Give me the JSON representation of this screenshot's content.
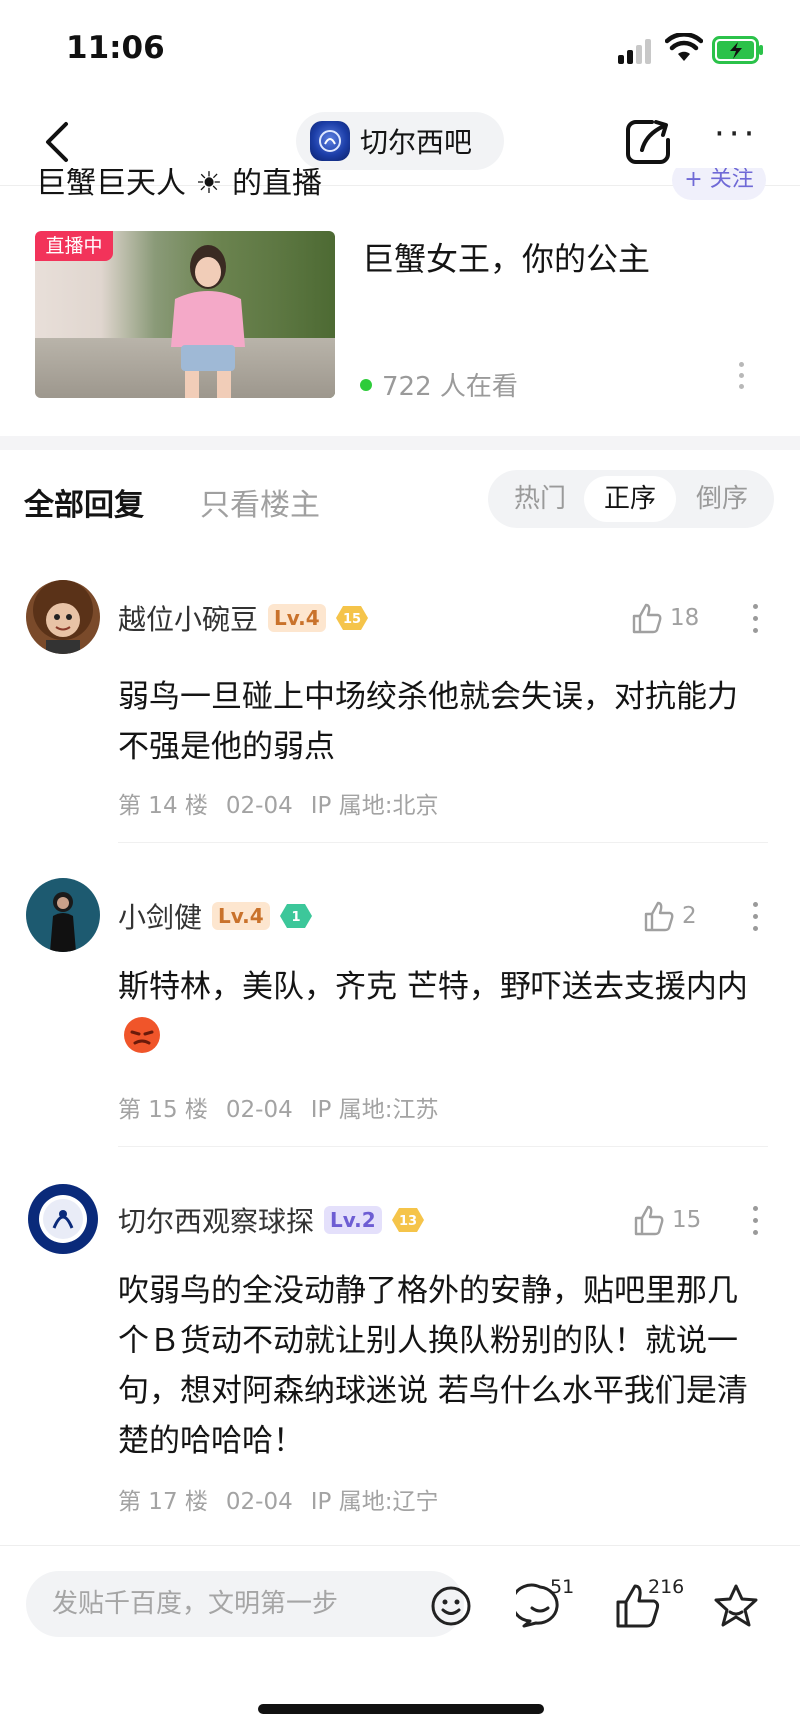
{
  "status": {
    "time": "11:06"
  },
  "nav": {
    "forum_name": "切尔西吧"
  },
  "live": {
    "title": "巨蟹巨天人 ☀ 的直播",
    "follow_label": "+ 关注",
    "badge": "直播中",
    "caption": "巨蟹女王，你的公主",
    "viewers": "722 人在看"
  },
  "filters": {
    "all": "全部回复",
    "owner_only": "只看楼主",
    "sort": [
      "热门",
      "正序",
      "倒序"
    ],
    "active_sort": "正序"
  },
  "replies": [
    {
      "user": "越位小碗豆",
      "level": "Lv.4",
      "badge": "15",
      "likes": "18",
      "text": "弱鸟一旦碰上中场绞杀他就会失误，对抗能力不强是他的弱点",
      "floor": "第 14 楼",
      "date": "02-04",
      "ip": "IP 属地:北京"
    },
    {
      "user": "小剑健",
      "level": "Lv.4",
      "badge": "1",
      "likes": "2",
      "text": "斯特林，美队，齐克 芒特，野吓送去支援内内",
      "floor": "第 15 楼",
      "date": "02-04",
      "ip": "IP 属地:江苏"
    },
    {
      "user": "切尔西观察球探",
      "level": "Lv.2",
      "badge": "13",
      "likes": "15",
      "text": "吹弱鸟的全没动静了格外的安静，贴吧里那几个Ｂ货动不动就让别人换队粉别的队！就说一句，想对阿森纳球迷说 若鸟什么水平我们是清楚的哈哈哈！",
      "floor": "第 17 楼",
      "date": "02-04",
      "ip": "IP 属地:辽宁"
    }
  ],
  "bottom": {
    "placeholder": "发贴千百度，文明第一步",
    "comment_count": "51",
    "like_count": "216"
  },
  "colors": {
    "live_badge": "#f2335a",
    "follow_text": "#6f69d6",
    "online_dot": "#2ecc3a",
    "level_orange": "#c9722b",
    "level_purple": "#6d5dd3"
  }
}
